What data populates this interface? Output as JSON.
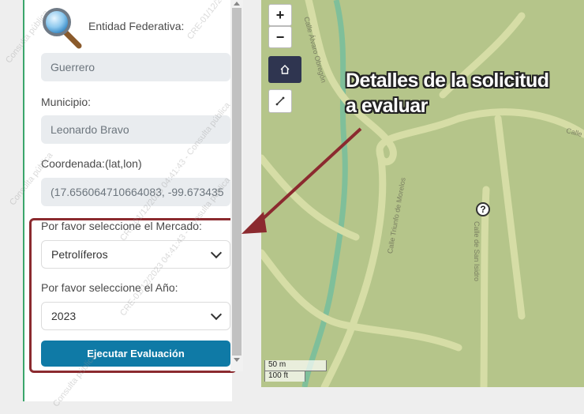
{
  "form": {
    "entity_label": "Entidad Federativa:",
    "entity_value": "Guerrero",
    "municipality_label": "Municipio:",
    "municipality_value": "Leonardo Bravo",
    "coord_label": "Coordenada:(lat,lon)",
    "coord_value": "(17.656064710664083, -99.673435",
    "market_label": "Por favor seleccione el Mercado:",
    "market_value": "Petrolíferos",
    "year_label": "Por favor seleccione el Año:",
    "year_value": "2023",
    "run_label": "Ejecutar Evaluación"
  },
  "map": {
    "zoom_in": "+",
    "zoom_out": "−",
    "scale_metric": "50 m",
    "scale_imperial": "100 ft",
    "streets": [
      "Calle Álvaro Obregón",
      "Calle Triunfo de Morelos",
      "Calle de San Isidro",
      "Calle"
    ],
    "marker": "?"
  },
  "annotation": {
    "line1": "Detalles de la solicitud",
    "line2": "a evaluar"
  },
  "watermark": {
    "text1": "Consulta pública",
    "text2": "CRE-01/12/2023 04:41:43 - Consulta pública",
    "text3": "CRE-01/12/2023 04:41:43"
  },
  "colors": {
    "accent": "#0f7aa6",
    "highlight": "#8b2a2f",
    "map_bg": "#b5c58a",
    "home_btn": "#2f3550"
  }
}
